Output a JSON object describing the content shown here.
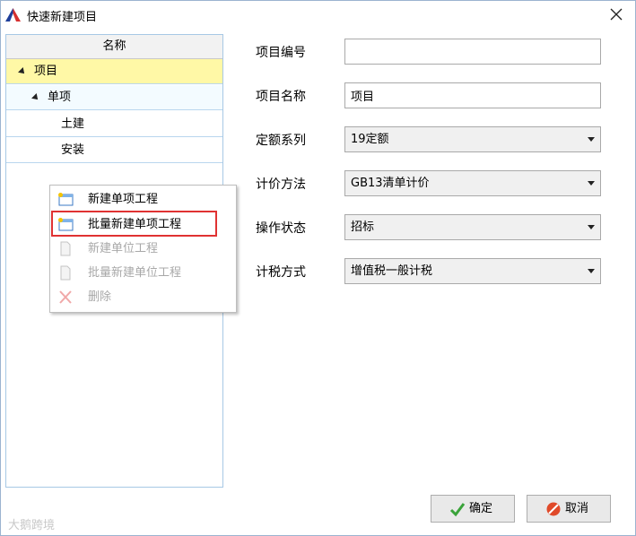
{
  "window": {
    "title": "快速新建项目"
  },
  "tree": {
    "header": "名称",
    "items": [
      {
        "label": "项目"
      },
      {
        "label": "单项"
      },
      {
        "label": "土建"
      },
      {
        "label": "安装"
      }
    ]
  },
  "context_menu": {
    "items": [
      {
        "label": "新建单项工程",
        "enabled": true
      },
      {
        "label": "批量新建单项工程",
        "enabled": true,
        "highlighted": true
      },
      {
        "label": "新建单位工程",
        "enabled": false
      },
      {
        "label": "批量新建单位工程",
        "enabled": false
      },
      {
        "label": "删除",
        "enabled": false
      }
    ]
  },
  "form": {
    "project_number_label": "项目编号",
    "project_number_value": "",
    "project_name_label": "项目名称",
    "project_name_value": "项目",
    "quota_series_label": "定额系列",
    "quota_series_value": "19定额",
    "pricing_method_label": "计价方法",
    "pricing_method_value": "GB13清单计价",
    "operation_status_label": "操作状态",
    "operation_status_value": "招标",
    "tax_method_label": "计税方式",
    "tax_method_value": "增值税一般计税"
  },
  "buttons": {
    "ok": "确定",
    "cancel": "取消"
  },
  "watermark": "大鹅跨境",
  "colors": {
    "selected_row": "#fff8a6",
    "highlight_border": "#e03232",
    "disabled_text": "#a8a8a8"
  }
}
